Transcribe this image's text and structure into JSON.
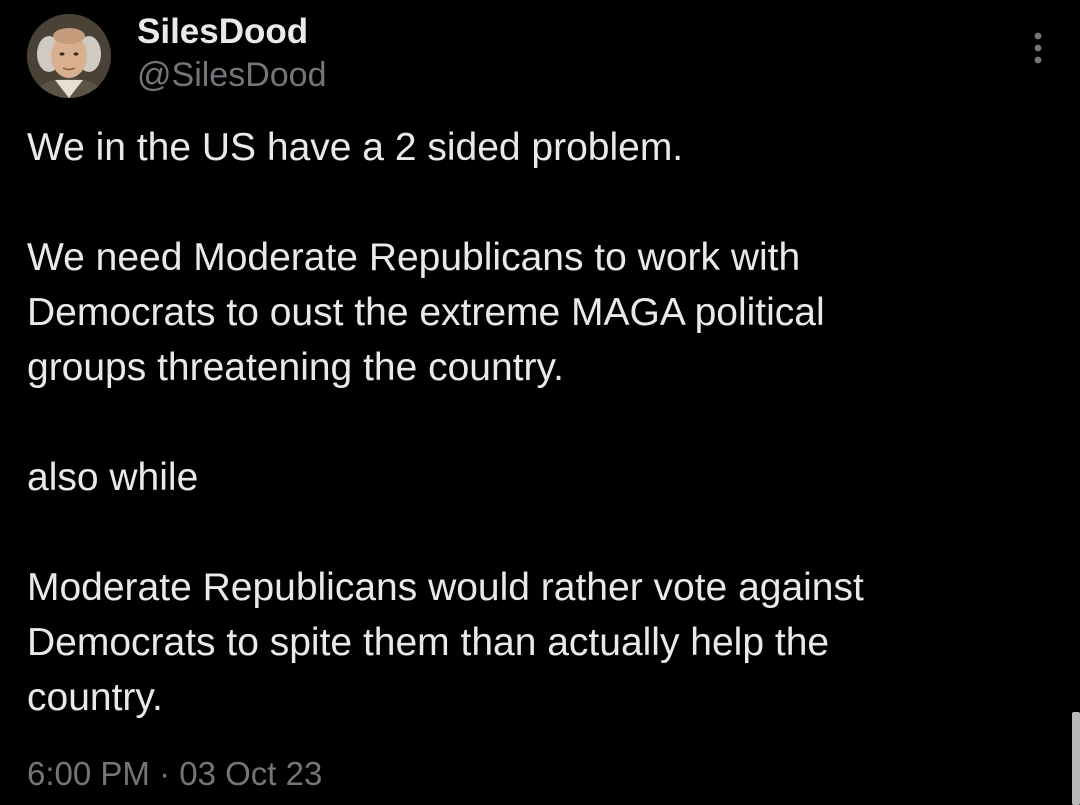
{
  "user": {
    "display_name": "SilesDood",
    "handle": "@SilesDood",
    "avatar_icon": "portrait-avatar-icon"
  },
  "menu": {
    "icon": "more-vertical-icon"
  },
  "tweet": {
    "paragraphs": [
      {
        "lines": [
          "We in the US have a 2 sided problem."
        ]
      },
      {
        "lines": [
          "We need Moderate Republicans to work with",
          "Democrats to oust the extreme MAGA political",
          "groups threatening the country."
        ]
      },
      {
        "lines": [
          "also while"
        ]
      },
      {
        "lines": [
          "Moderate Republicans would rather vote against",
          "Democrats to spite them than actually help the",
          "country."
        ]
      }
    ],
    "timestamp": "6:00 PM · 03 Oct 23"
  },
  "colors": {
    "background": "#000000",
    "primary_text": "#e7e9ea",
    "secondary_text": "#71767b"
  }
}
